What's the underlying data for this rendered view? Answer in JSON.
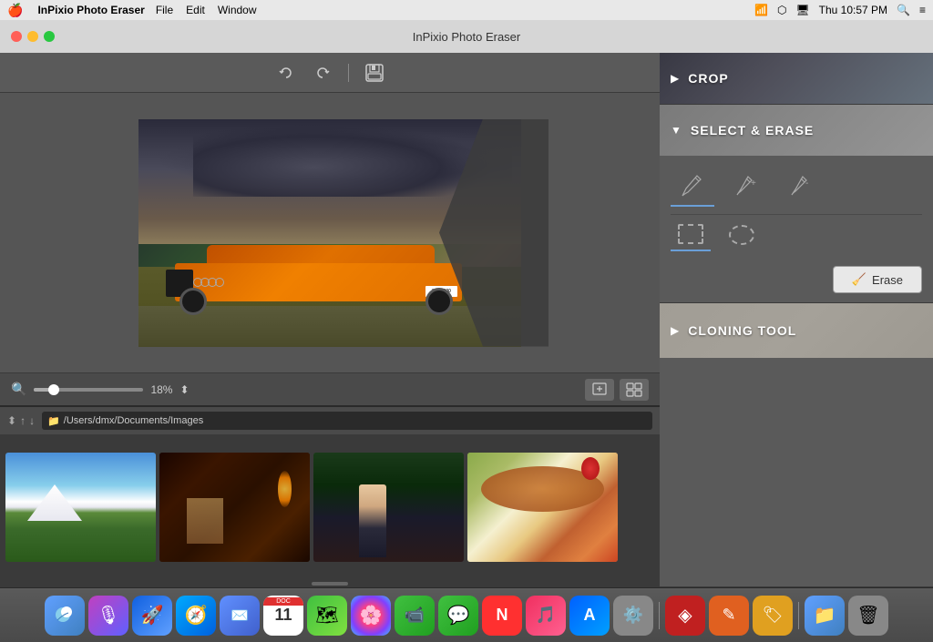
{
  "menubar": {
    "apple": "🍎",
    "app_name": "InPixio Photo Eraser",
    "menu_items": [
      "File",
      "Edit",
      "Window"
    ],
    "time": "Thu 10:57 PM",
    "title": "InPixio Photo Eraser"
  },
  "toolbar": {
    "undo_label": "↺",
    "redo_label": "↻",
    "save_label": "💾"
  },
  "zoom": {
    "value": "18%",
    "fit_label": "⤓",
    "expand_label": "⊞"
  },
  "file_browser": {
    "path": "/Users/dmx/Documents/Images",
    "sort_asc": "↑",
    "sort_desc": "↓"
  },
  "right_panel": {
    "crop_label": "CROP",
    "select_erase_label": "SELECT & ERASE",
    "cloning_tool_label": "CLONING TOOL",
    "erase_button_label": "Erase",
    "tools": [
      {
        "name": "brush",
        "icon": "✏️"
      },
      {
        "name": "brush-add",
        "icon": "✏️+"
      },
      {
        "name": "brush-remove",
        "icon": "✏️-"
      }
    ]
  },
  "dock": {
    "items": [
      {
        "name": "finder",
        "icon": "🖥",
        "color": "dock-finder"
      },
      {
        "name": "siri",
        "icon": "🎵",
        "color": "dock-siri"
      },
      {
        "name": "launchpad",
        "icon": "🚀",
        "color": "dock-launchpad"
      },
      {
        "name": "safari",
        "icon": "🧭",
        "color": "dock-safari"
      },
      {
        "name": "mail",
        "icon": "✉️",
        "color": "dock-mail"
      },
      {
        "name": "calendar",
        "day": "11"
      },
      {
        "name": "maps",
        "icon": "🗺",
        "color": "dock-maps"
      },
      {
        "name": "photos",
        "icon": "🌸",
        "color": "dock-photos"
      },
      {
        "name": "facetime",
        "icon": "📹",
        "color": "dock-facetime"
      },
      {
        "name": "messages",
        "icon": "💬",
        "color": "dock-messages"
      },
      {
        "name": "news",
        "icon": "📰",
        "color": "dock-news"
      },
      {
        "name": "music",
        "icon": "🎵",
        "color": "dock-music"
      },
      {
        "name": "appstore",
        "icon": "🅰",
        "color": "dock-appstore"
      },
      {
        "name": "settings",
        "icon": "⚙️",
        "color": "dock-settings"
      },
      {
        "name": "inpixio-red",
        "icon": "🔴",
        "color": "dock-red"
      },
      {
        "name": "inpixio-orange",
        "icon": "⬡",
        "color": "dock-orange"
      },
      {
        "name": "inpixio-yellow",
        "icon": "⬡",
        "color": "dock-yellow"
      },
      {
        "name": "finder2",
        "icon": "📁",
        "color": "dock-finder"
      },
      {
        "name": "trash",
        "icon": "🗑",
        "color": "dock-trash"
      }
    ]
  }
}
